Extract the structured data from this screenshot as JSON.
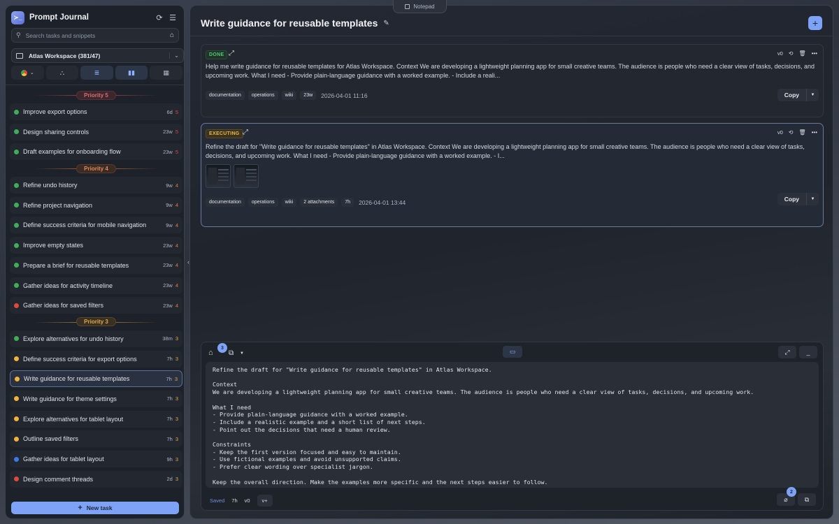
{
  "app": {
    "title": "Prompt Journal",
    "logo_glyph": "≻_"
  },
  "notepad_tab": {
    "label": "Notepad"
  },
  "search": {
    "placeholder": "Search tasks and snippets"
  },
  "workspace": {
    "label": "Atlas Workspace (381/47)"
  },
  "view_buttons": [
    "chrome-icon",
    "tree-icon",
    "list-indent-icon",
    "bar-chart-icon",
    "calendar-icon"
  ],
  "priority_groups": [
    {
      "label": "Priority 5",
      "tasks": [
        {
          "name": "Improve export options",
          "age": "6d",
          "prio": "5",
          "status": "green"
        },
        {
          "name": "Design sharing controls",
          "age": "23w",
          "prio": "5",
          "status": "green"
        },
        {
          "name": "Draft examples for onboarding flow",
          "age": "23w",
          "prio": "5",
          "status": "green"
        }
      ]
    },
    {
      "label": "Priority 4",
      "tasks": [
        {
          "name": "Refine undo history",
          "age": "9w",
          "prio": "4",
          "status": "green"
        },
        {
          "name": "Refine project navigation",
          "age": "9w",
          "prio": "4",
          "status": "green"
        },
        {
          "name": "Define success criteria for mobile navigation",
          "age": "9w",
          "prio": "4",
          "status": "green"
        },
        {
          "name": "Improve empty states",
          "age": "23w",
          "prio": "4",
          "status": "green"
        },
        {
          "name": "Prepare a brief for reusable templates",
          "age": "23w",
          "prio": "4",
          "status": "green"
        },
        {
          "name": "Gather ideas for activity timeline",
          "age": "23w",
          "prio": "4",
          "status": "green"
        },
        {
          "name": "Gather ideas for saved filters",
          "age": "23w",
          "prio": "4",
          "status": "red"
        }
      ]
    },
    {
      "label": "Priority 3",
      "tasks": [
        {
          "name": "Explore alternatives for undo history",
          "age": "38m",
          "prio": "3",
          "status": "green"
        },
        {
          "name": "Define success criteria for export options",
          "age": "7h",
          "prio": "3",
          "status": "yellow"
        },
        {
          "name": "Write guidance for reusable templates",
          "age": "7h",
          "prio": "3",
          "status": "yellow",
          "selected": true
        },
        {
          "name": "Write guidance for theme settings",
          "age": "7h",
          "prio": "3",
          "status": "yellow"
        },
        {
          "name": "Explore alternatives for tablet layout",
          "age": "7h",
          "prio": "3",
          "status": "yellow"
        },
        {
          "name": "Outline saved filters",
          "age": "7h",
          "prio": "3",
          "status": "yellow"
        },
        {
          "name": "Gather ideas for tablet layout",
          "age": "9h",
          "prio": "3",
          "status": "blue"
        },
        {
          "name": "Design comment threads",
          "age": "2d",
          "prio": "3",
          "status": "red"
        }
      ]
    }
  ],
  "new_task": {
    "label": "New task"
  },
  "main": {
    "title": "Write guidance for reusable templates",
    "add_label": "+"
  },
  "cards": [
    {
      "status": "DONE",
      "version": "v0",
      "text": "Help me write guidance for reusable templates for Atlas Workspace. Context We are developing a lightweight planning app for small creative teams. The audience is people who need a clear view of tasks, decisions, and upcoming work. What I need - Provide plain-language guidance with a worked example. - Include a reali...",
      "tags": [
        "documentation",
        "operations",
        "wiki",
        "23w"
      ],
      "timestamp": "2026-04-01 11:16",
      "copy_label": "Copy"
    },
    {
      "status": "EXECUTING",
      "version": "v0",
      "text": "Refine the draft for \"Write guidance for reusable templates\" in Atlas Workspace. Context We are developing a lightweight planning app for small creative teams. The audience is people who need a clear view of tasks, decisions, and upcoming work. What I need - Provide plain-language guidance with a worked example. - I...",
      "tags": [
        "documentation",
        "operations",
        "wiki",
        "2 attachments",
        "7h"
      ],
      "timestamp": "2026-04-01 13:44",
      "copy_label": "Copy"
    }
  ],
  "editor": {
    "tag_count": "3",
    "attachment_count": "2",
    "text": "Refine the draft for \"Write guidance for reusable templates\" in Atlas Workspace.\n\nContext\nWe are developing a lightweight planning app for small creative teams. The audience is people who need a clear view of tasks, decisions, and upcoming work.\n\nWhat I need\n- Provide plain-language guidance with a worked example.\n- Include a realistic example and a short list of next steps.\n- Point out the decisions that need a human review.\n\nConstraints\n- Keep the first version focused and easy to maintain.\n- Use fictional examples and avoid unsupported claims.\n- Prefer clear wording over specialist jargon.\n\nKeep the overall direction. Make the examples more specific and the next steps easier to follow.",
    "footer": {
      "saved": "Saved",
      "age": "7h",
      "version": "v0",
      "vplus": "v+"
    }
  },
  "colors": {
    "accent": "#7ea2f5",
    "status_green": "#3fae5a",
    "status_yellow": "#f0b43a",
    "status_red": "#e0483f",
    "status_blue": "#3c79e6"
  }
}
